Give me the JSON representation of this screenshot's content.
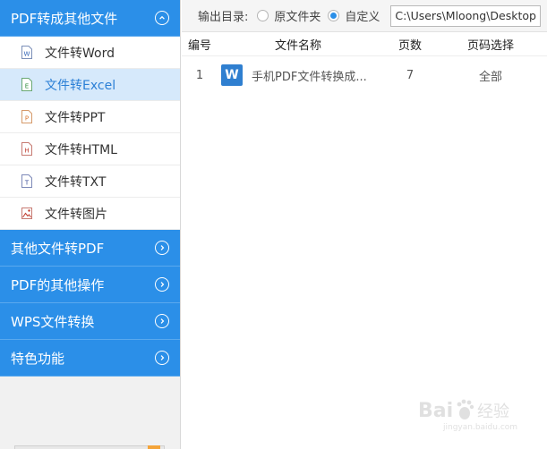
{
  "sidebar": {
    "sections": [
      {
        "label": "PDF转成其他文件",
        "expanded": true
      },
      {
        "label": "其他文件转PDF",
        "expanded": false
      },
      {
        "label": "PDF的其他操作",
        "expanded": false
      },
      {
        "label": "WPS文件转换",
        "expanded": false
      },
      {
        "label": "特色功能",
        "expanded": false
      }
    ],
    "sub_items": [
      {
        "label": "文件转Word",
        "icon": "word-file-icon",
        "letter": "W",
        "color": "#2b5fb5"
      },
      {
        "label": "文件转Excel",
        "icon": "excel-file-icon",
        "letter": "E",
        "color": "#2e8b3a"
      },
      {
        "label": "文件转PPT",
        "icon": "ppt-file-icon",
        "letter": "P",
        "color": "#d8732a"
      },
      {
        "label": "文件转HTML",
        "icon": "html-file-icon",
        "letter": "H",
        "color": "#c0392b"
      },
      {
        "label": "文件转TXT",
        "icon": "txt-file-icon",
        "letter": "T",
        "color": "#3a4d9a"
      },
      {
        "label": "文件转图片",
        "icon": "image-file-icon",
        "letter": "",
        "color": "#c0392b"
      }
    ],
    "active_index": 1
  },
  "output": {
    "label": "输出目录:",
    "option_original": "原文件夹",
    "option_custom": "自定义",
    "selected": "custom",
    "path": "C:\\Users\\Mloong\\Desktop"
  },
  "table": {
    "headers": [
      "编号",
      "文件名称",
      "页数",
      "页码选择"
    ],
    "rows": [
      {
        "num": "1",
        "name": "手机PDF文件转换成...",
        "pages": "7",
        "range": "全部",
        "file_type_letter": "W"
      }
    ]
  },
  "watermark": {
    "text": "Bai经验",
    "subtext": "jingyan.baidu.com"
  },
  "colors": {
    "accent": "#2b8fe8",
    "active_bg": "#d6e9fb",
    "word_blue": "#2f7fd0"
  }
}
